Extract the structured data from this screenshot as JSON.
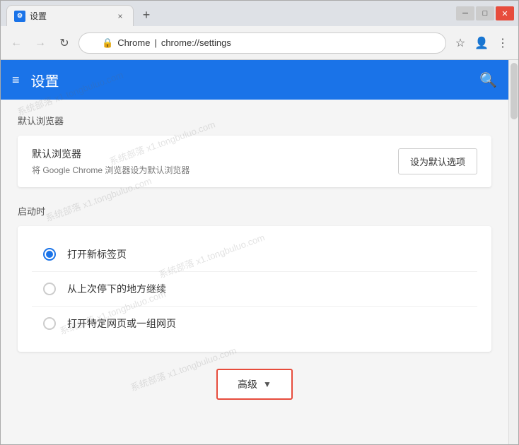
{
  "window": {
    "title": "设置",
    "tab_title": "设置",
    "controls": {
      "minimize": "─",
      "maximize": "□",
      "close": "✕"
    }
  },
  "address_bar": {
    "back_icon": "←",
    "forward_icon": "→",
    "refresh_icon": "↻",
    "lock_icon": "🔒",
    "url_prefix": "Chrome",
    "url_separator": "|",
    "url_path": "chrome://settings",
    "bookmark_icon": "☆",
    "account_icon": "👤",
    "menu_icon": "⋮",
    "new_tab_icon": "+"
  },
  "settings_header": {
    "hamburger_icon": "≡",
    "title": "设置",
    "search_icon": "🔍"
  },
  "default_browser_section": {
    "section_title": "默认浏览器",
    "card": {
      "label": "默认浏览器",
      "description": "将 Google Chrome 浏览器设为默认浏览器",
      "button_label": "设为默认选项"
    }
  },
  "startup_section": {
    "section_title": "启动时",
    "options": [
      {
        "label": "打开新标签页",
        "selected": true
      },
      {
        "label": "从上次停下的地方继续",
        "selected": false
      },
      {
        "label": "打开特定网页或一组网页",
        "selected": false
      }
    ]
  },
  "advanced_button": {
    "label": "高级",
    "arrow": "▼"
  },
  "colors": {
    "header_bg": "#1a73e8",
    "selected_radio": "#1a73e8",
    "advanced_border": "#e74c3c"
  }
}
